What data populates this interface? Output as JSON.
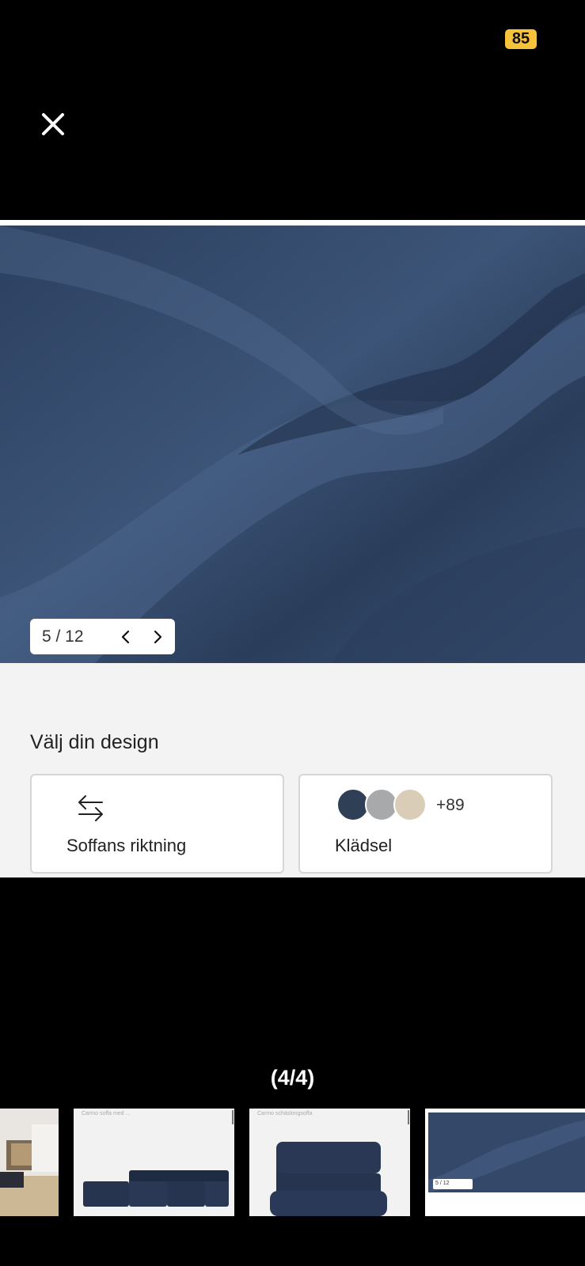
{
  "status": {
    "badge": "85"
  },
  "viewer": {
    "close_icon": "close-icon",
    "counter": "(4/4)"
  },
  "product": {
    "pager": {
      "text": "5 / 12",
      "prev_icon": "chevron-left-icon",
      "next_icon": "chevron-right-icon"
    },
    "design_title": "Välj din design",
    "options": [
      {
        "label": "Soffans riktning",
        "icon": "swap-arrows-icon"
      },
      {
        "label": "Klädsel",
        "extra": "+89",
        "swatch_colors": [
          "#2f3f55",
          "#a8a9ab",
          "#d9cdb8"
        ]
      }
    ]
  },
  "thumbnails": [
    {
      "caption": "",
      "kind": "room-photo"
    },
    {
      "caption": "Carmo soffa med ... ",
      "kind": "sofa-low"
    },
    {
      "caption": "Carmo schäslongsoffa",
      "kind": "sofa-chaise"
    },
    {
      "caption": "",
      "kind": "fabric",
      "pager": "5 / 12"
    }
  ],
  "colors": {
    "fabric": "#33496a",
    "badge": "#f6c33a",
    "sofa": "#27344f"
  }
}
